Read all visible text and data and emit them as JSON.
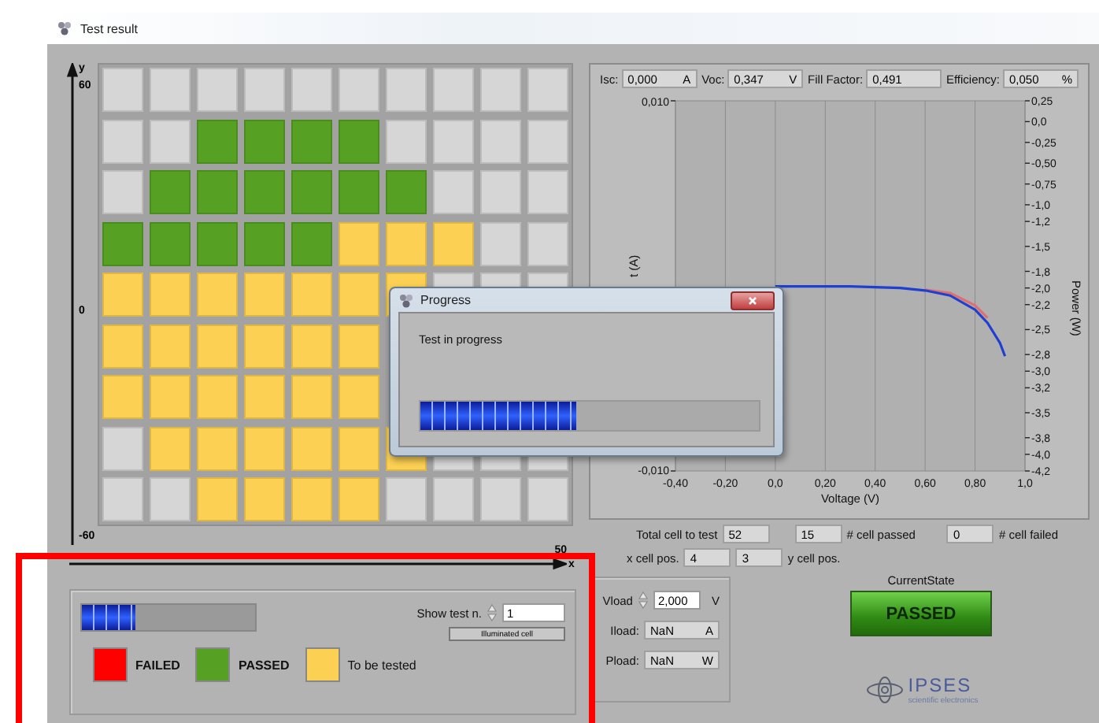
{
  "window": {
    "title": "Test result"
  },
  "cell_map": {
    "y_axis": {
      "label": "y",
      "ticks": [
        "60",
        "0",
        "-60"
      ]
    },
    "x_axis": {
      "label": "x",
      "ticks": [
        "50"
      ]
    },
    "rows": [
      {
        "cells": [
          {
            "color": "#d6d6d6"
          },
          {
            "color": "#d6d6d6"
          },
          {
            "color": "#d6d6d6"
          },
          {
            "color": "#d6d6d6"
          },
          {
            "color": "#d6d6d6"
          },
          {
            "color": "#d6d6d6"
          },
          {
            "color": "#d6d6d6"
          },
          {
            "color": "#d6d6d6"
          },
          {
            "color": "#d6d6d6"
          },
          {
            "color": "#d6d6d6"
          }
        ]
      },
      {
        "cells": [
          {
            "color": "#d6d6d6"
          },
          {
            "color": "#d6d6d6"
          },
          {
            "color": "#56a023"
          },
          {
            "color": "#56a023"
          },
          {
            "color": "#56a023"
          },
          {
            "color": "#56a023"
          },
          {
            "color": "#d6d6d6"
          },
          {
            "color": "#d6d6d6"
          },
          {
            "color": "#d6d6d6"
          },
          {
            "color": "#d6d6d6"
          }
        ]
      },
      {
        "cells": [
          {
            "color": "#d6d6d6"
          },
          {
            "color": "#56a023"
          },
          {
            "color": "#56a023"
          },
          {
            "color": "#56a023"
          },
          {
            "color": "#56a023"
          },
          {
            "color": "#56a023"
          },
          {
            "color": "#56a023"
          },
          {
            "color": "#d6d6d6"
          },
          {
            "color": "#d6d6d6"
          },
          {
            "color": "#d6d6d6"
          }
        ]
      },
      {
        "cells": [
          {
            "color": "#56a023"
          },
          {
            "color": "#56a023"
          },
          {
            "color": "#56a023"
          },
          {
            "color": "#56a023"
          },
          {
            "color": "#56a023"
          },
          {
            "color": "#fcd052"
          },
          {
            "color": "#fcd052"
          },
          {
            "color": "#fcd052"
          },
          {
            "color": "#d6d6d6"
          },
          {
            "color": "#d6d6d6"
          }
        ]
      },
      {
        "cells": [
          {
            "color": "#fcd052"
          },
          {
            "color": "#fcd052"
          },
          {
            "color": "#fcd052"
          },
          {
            "color": "#fcd052"
          },
          {
            "color": "#fcd052"
          },
          {
            "color": "#fcd052"
          },
          {
            "color": "#fcd052"
          },
          {
            "color": "#d6d6d6"
          },
          {
            "color": "#d6d6d6"
          },
          {
            "color": "#d6d6d6"
          }
        ]
      },
      {
        "cells": [
          {
            "color": "#fcd052"
          },
          {
            "color": "#fcd052"
          },
          {
            "color": "#fcd052"
          },
          {
            "color": "#fcd052"
          },
          {
            "color": "#fcd052"
          },
          {
            "color": "#fcd052"
          },
          null,
          null,
          null,
          null
        ]
      },
      {
        "cells": [
          {
            "color": "#fcd052"
          },
          {
            "color": "#fcd052"
          },
          {
            "color": "#fcd052"
          },
          {
            "color": "#fcd052"
          },
          {
            "color": "#fcd052"
          },
          {
            "color": "#fcd052"
          },
          null,
          null,
          null,
          null
        ]
      },
      {
        "cells": [
          {
            "color": "#d6d6d6"
          },
          {
            "color": "#fcd052"
          },
          {
            "color": "#fcd052"
          },
          {
            "color": "#fcd052"
          },
          {
            "color": "#fcd052"
          },
          {
            "color": "#fcd052"
          },
          {
            "color": "#fcd052"
          },
          {
            "color": "#d6d6d6"
          },
          {
            "color": "#d6d6d6"
          },
          {
            "color": "#d6d6d6"
          }
        ]
      },
      {
        "cells": [
          {
            "color": "#d6d6d6"
          },
          {
            "color": "#d6d6d6"
          },
          {
            "color": "#fcd052"
          },
          {
            "color": "#fcd052"
          },
          {
            "color": "#fcd052"
          },
          {
            "color": "#fcd052"
          },
          {
            "color": "#d6d6d6"
          },
          {
            "color": "#d6d6d6"
          },
          {
            "color": "#d6d6d6"
          },
          {
            "color": "#d6d6d6"
          }
        ]
      }
    ]
  },
  "iv_panel": {
    "readouts": [
      {
        "label": "Isc:",
        "value": "0,000",
        "unit": "A"
      },
      {
        "label": "Voc:",
        "value": "0,347",
        "unit": "V"
      },
      {
        "label": "Fill Factor:",
        "value": "0,491"
      },
      {
        "label": "Efficiency:",
        "value": "0,050",
        "unit": "%"
      }
    ],
    "current_axis": {
      "label": "t (A)",
      "ticks": [
        "0,010",
        "-0,010"
      ]
    },
    "chart_data": {
      "type": "line",
      "xlabel": "Voltage (V)",
      "ylabel": "Power (W)",
      "x": [
        0.0,
        0.1,
        0.2,
        0.3,
        0.4,
        0.5,
        0.6,
        0.7,
        0.8,
        0.85,
        0.9,
        0.92
      ],
      "grid": true,
      "series": [
        {
          "color": "#e07070",
          "values": [
            null,
            null,
            null,
            null,
            null,
            null,
            -2.02,
            -2.06,
            -2.21,
            -2.36,
            null,
            null
          ]
        },
        {
          "color": "#1f3fd0",
          "values": [
            -1.98,
            -1.98,
            -1.98,
            -1.98,
            -1.99,
            -2.0,
            -2.03,
            -2.09,
            -2.26,
            -2.42,
            -2.66,
            -2.82
          ]
        }
      ],
      "xlim": [
        -0.4,
        1.0
      ],
      "ylim": [
        -4.2,
        0.25
      ],
      "xticks": [
        {
          "value": -0.4,
          "label": "-0,40"
        },
        {
          "value": -0.2,
          "label": "-0,20"
        },
        {
          "value": 0,
          "label": "0,0"
        },
        {
          "value": 0.2,
          "label": "0,20"
        },
        {
          "value": 0.4,
          "label": "0,40"
        },
        {
          "value": 0.6,
          "label": "0,60"
        },
        {
          "value": 0.8,
          "label": "0,80"
        },
        {
          "value": 1.0,
          "label": "1,0"
        }
      ],
      "yticks": [
        {
          "value": 0.25,
          "label": "0,25"
        },
        {
          "value": 0,
          "label": "0,0"
        },
        {
          "value": -0.25,
          "label": "-0,25"
        },
        {
          "value": -0.5,
          "label": "-0,50"
        },
        {
          "value": -0.75,
          "label": "-0,75"
        },
        {
          "value": -1.0,
          "label": "-1,0"
        },
        {
          "value": -1.2,
          "label": "-1,2"
        },
        {
          "value": -1.5,
          "label": "-1,5"
        },
        {
          "value": -1.8,
          "label": "-1,8"
        },
        {
          "value": -2.0,
          "label": "-2,0"
        },
        {
          "value": -2.2,
          "label": "-2,2"
        },
        {
          "value": -2.5,
          "label": "-2,5"
        },
        {
          "value": -2.8,
          "label": "-2,8"
        },
        {
          "value": -3.0,
          "label": "-3,0"
        },
        {
          "value": -3.2,
          "label": "-3,2"
        },
        {
          "value": -3.5,
          "label": "-3,5"
        },
        {
          "value": -3.8,
          "label": "-3,8"
        },
        {
          "value": -4.0,
          "label": "-4,0"
        },
        {
          "value": -4.2,
          "label": "-4,2"
        }
      ]
    }
  },
  "counters": {
    "total": {
      "label": "Total cell to test",
      "value": "52"
    },
    "passed": {
      "value": "15",
      "label": "# cell passed"
    },
    "failed": {
      "value": "0",
      "label": "# cell failed"
    },
    "x_pos": {
      "label": "x cell pos.",
      "value": "4"
    },
    "y_pos": {
      "value": "3",
      "label": "y cell pos."
    }
  },
  "test_panel": {
    "progress": {
      "level": 0.31
    },
    "legend": [
      {
        "label": "FAILED",
        "color": "#ff0000"
      },
      {
        "label": "PASSED",
        "color": "#56a023"
      },
      {
        "label": "To be tested",
        "color": "#fcd052"
      }
    ],
    "show_test": {
      "label": "Show test n.",
      "value": "1"
    },
    "button": "Illuminated cell"
  },
  "load_panel": {
    "vload": {
      "label": "Vload",
      "value": "2,000",
      "unit": "V"
    },
    "readouts": [
      {
        "label": "Iload:",
        "value": "NaN",
        "unit": "A"
      },
      {
        "label": "Pload:",
        "value": "NaN",
        "unit": "W"
      }
    ]
  },
  "state": {
    "label": "CurrentState",
    "value": "PASSED",
    "kind": "passed"
  },
  "logo": {
    "name": "IPSES",
    "tagline": "scientific electronics"
  },
  "dialog": {
    "title": "Progress",
    "message": "Test in progress",
    "progress": {
      "level": 0.46
    }
  }
}
